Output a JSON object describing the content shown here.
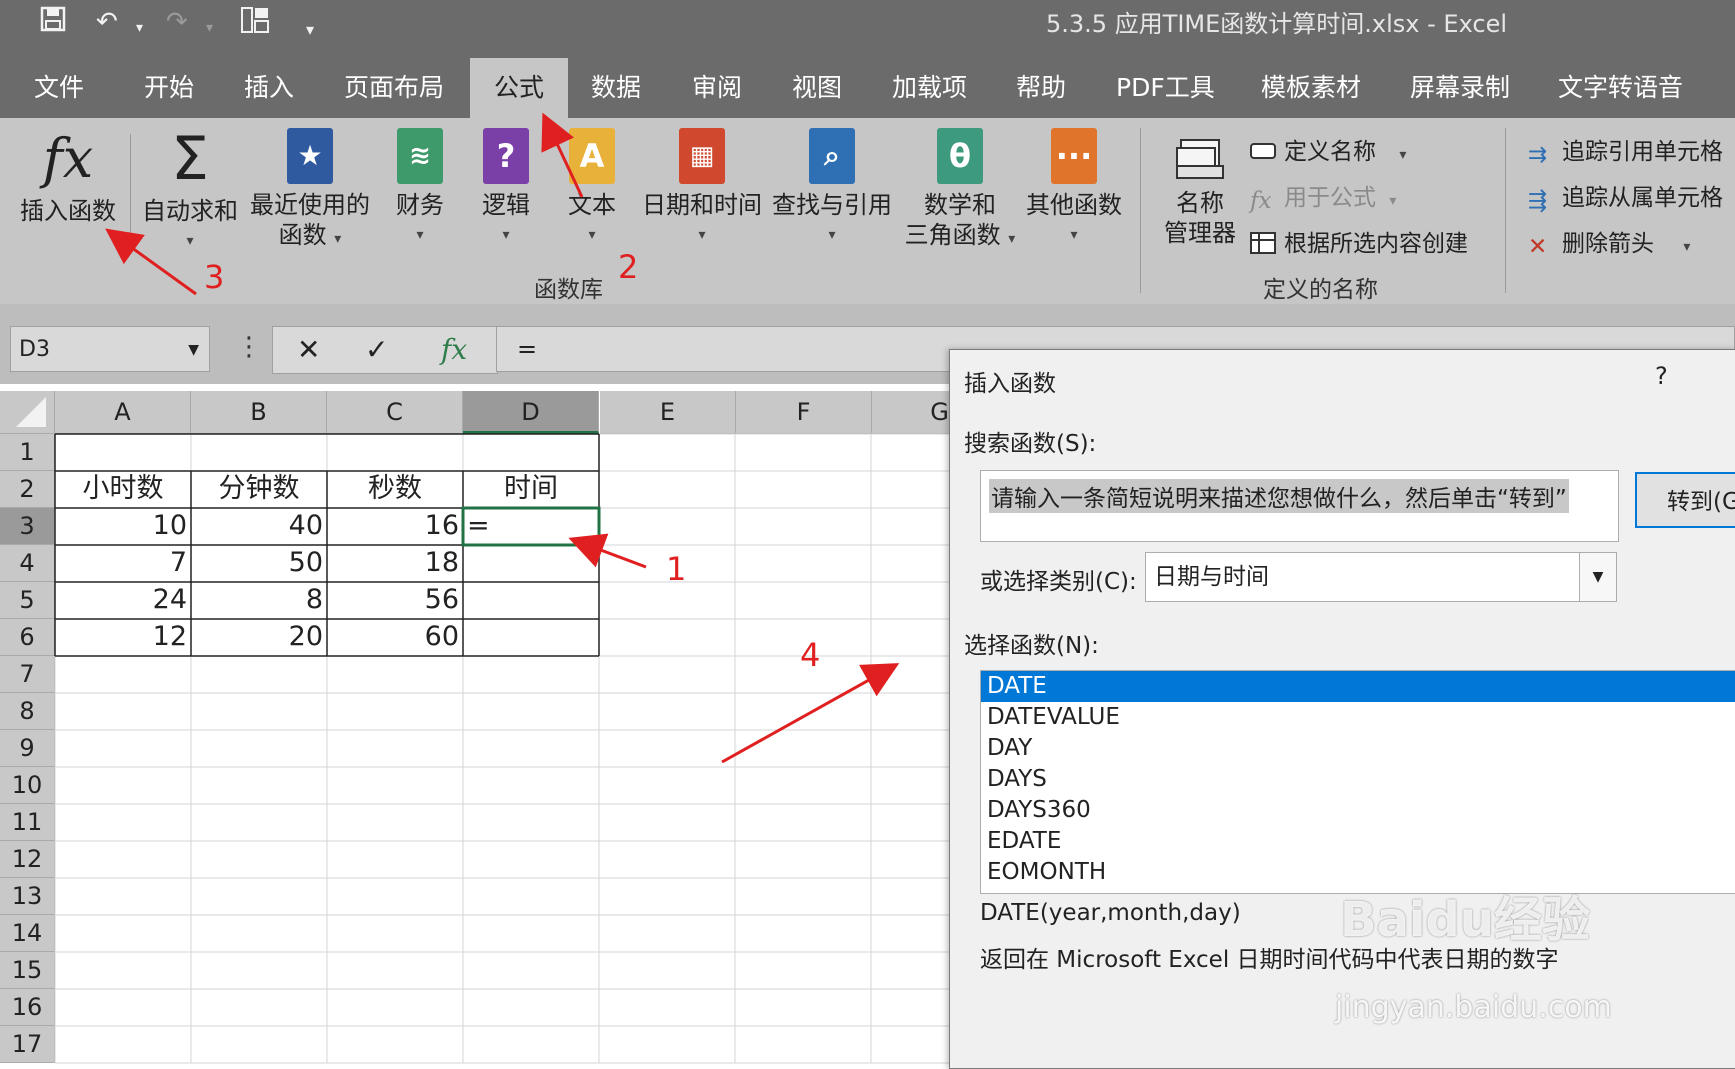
{
  "titlebar": {
    "title": "5.3.5   应用TIME函数计算时间.xlsx  -  Excel"
  },
  "tabs": [
    "文件",
    "开始",
    "插入",
    "页面布局",
    "公式",
    "数据",
    "审阅",
    "视图",
    "加载项",
    "帮助",
    "PDF工具",
    "模板素材",
    "屏幕录制",
    "文字转语音"
  ],
  "ribbon": {
    "insert_function": "插入函数",
    "autosum": "自动求和",
    "recent_line1": "最近使用的",
    "recent_line2": "函数",
    "financial": "财务",
    "logical": "逻辑",
    "text": "文本",
    "datetime": "日期和时间",
    "lookup": "查找与引用",
    "math_line1": "数学和",
    "math_line2": "三角函数",
    "other": "其他函数",
    "function_library": "函数库",
    "name_manager_line1": "名称",
    "name_manager_line2": "管理器",
    "define_name": "定义名称",
    "use_in_formula": "用于公式",
    "create_from_selection": "根据所选内容创建",
    "defined_names": "定义的名称",
    "trace_precedents": "追踪引用单元格",
    "trace_dependents": "追踪从属单元格",
    "remove_arrows": "删除箭头"
  },
  "formula_bar": {
    "name_box": "D3",
    "content": "="
  },
  "columns": [
    "A",
    "B",
    "C",
    "D",
    "E",
    "F",
    "G"
  ],
  "rows": [
    "1",
    "2",
    "3",
    "4",
    "5",
    "6",
    "7",
    "8",
    "9",
    "10",
    "11",
    "12",
    "13",
    "14",
    "15",
    "16",
    "17"
  ],
  "sheet": {
    "headers": [
      "小时数",
      "分钟数",
      "秒数",
      "时间"
    ],
    "data": [
      [
        "10",
        "40",
        "16",
        "="
      ],
      [
        "7",
        "50",
        "18",
        ""
      ],
      [
        "24",
        "8",
        "56",
        ""
      ],
      [
        "12",
        "20",
        "60",
        ""
      ]
    ]
  },
  "annotations": [
    "1",
    "2",
    "3",
    "4"
  ],
  "dialog": {
    "title": "插入函数",
    "help": "?",
    "search_label": "搜索函数(S):",
    "search_text": "请输入一条简短说明来描述您想做什么，然后单击“转到”",
    "goto": "转到(G",
    "category_label": "或选择类别(C):",
    "category_value": "日期与时间",
    "select_label": "选择函数(N):",
    "functions": [
      "DATE",
      "DATEVALUE",
      "DAY",
      "DAYS",
      "DAYS360",
      "EDATE",
      "EOMONTH"
    ],
    "signature": "DATE(year,month,day)",
    "description": "返回在 Microsoft Excel 日期时间代码中代表日期的数字"
  },
  "watermark": {
    "brand": "Baidu经验",
    "url": "jingyan.baidu.com"
  },
  "colors": {
    "accent_green": "#217346",
    "selection_blue": "#0078d7",
    "annotation_red": "#e02020"
  }
}
